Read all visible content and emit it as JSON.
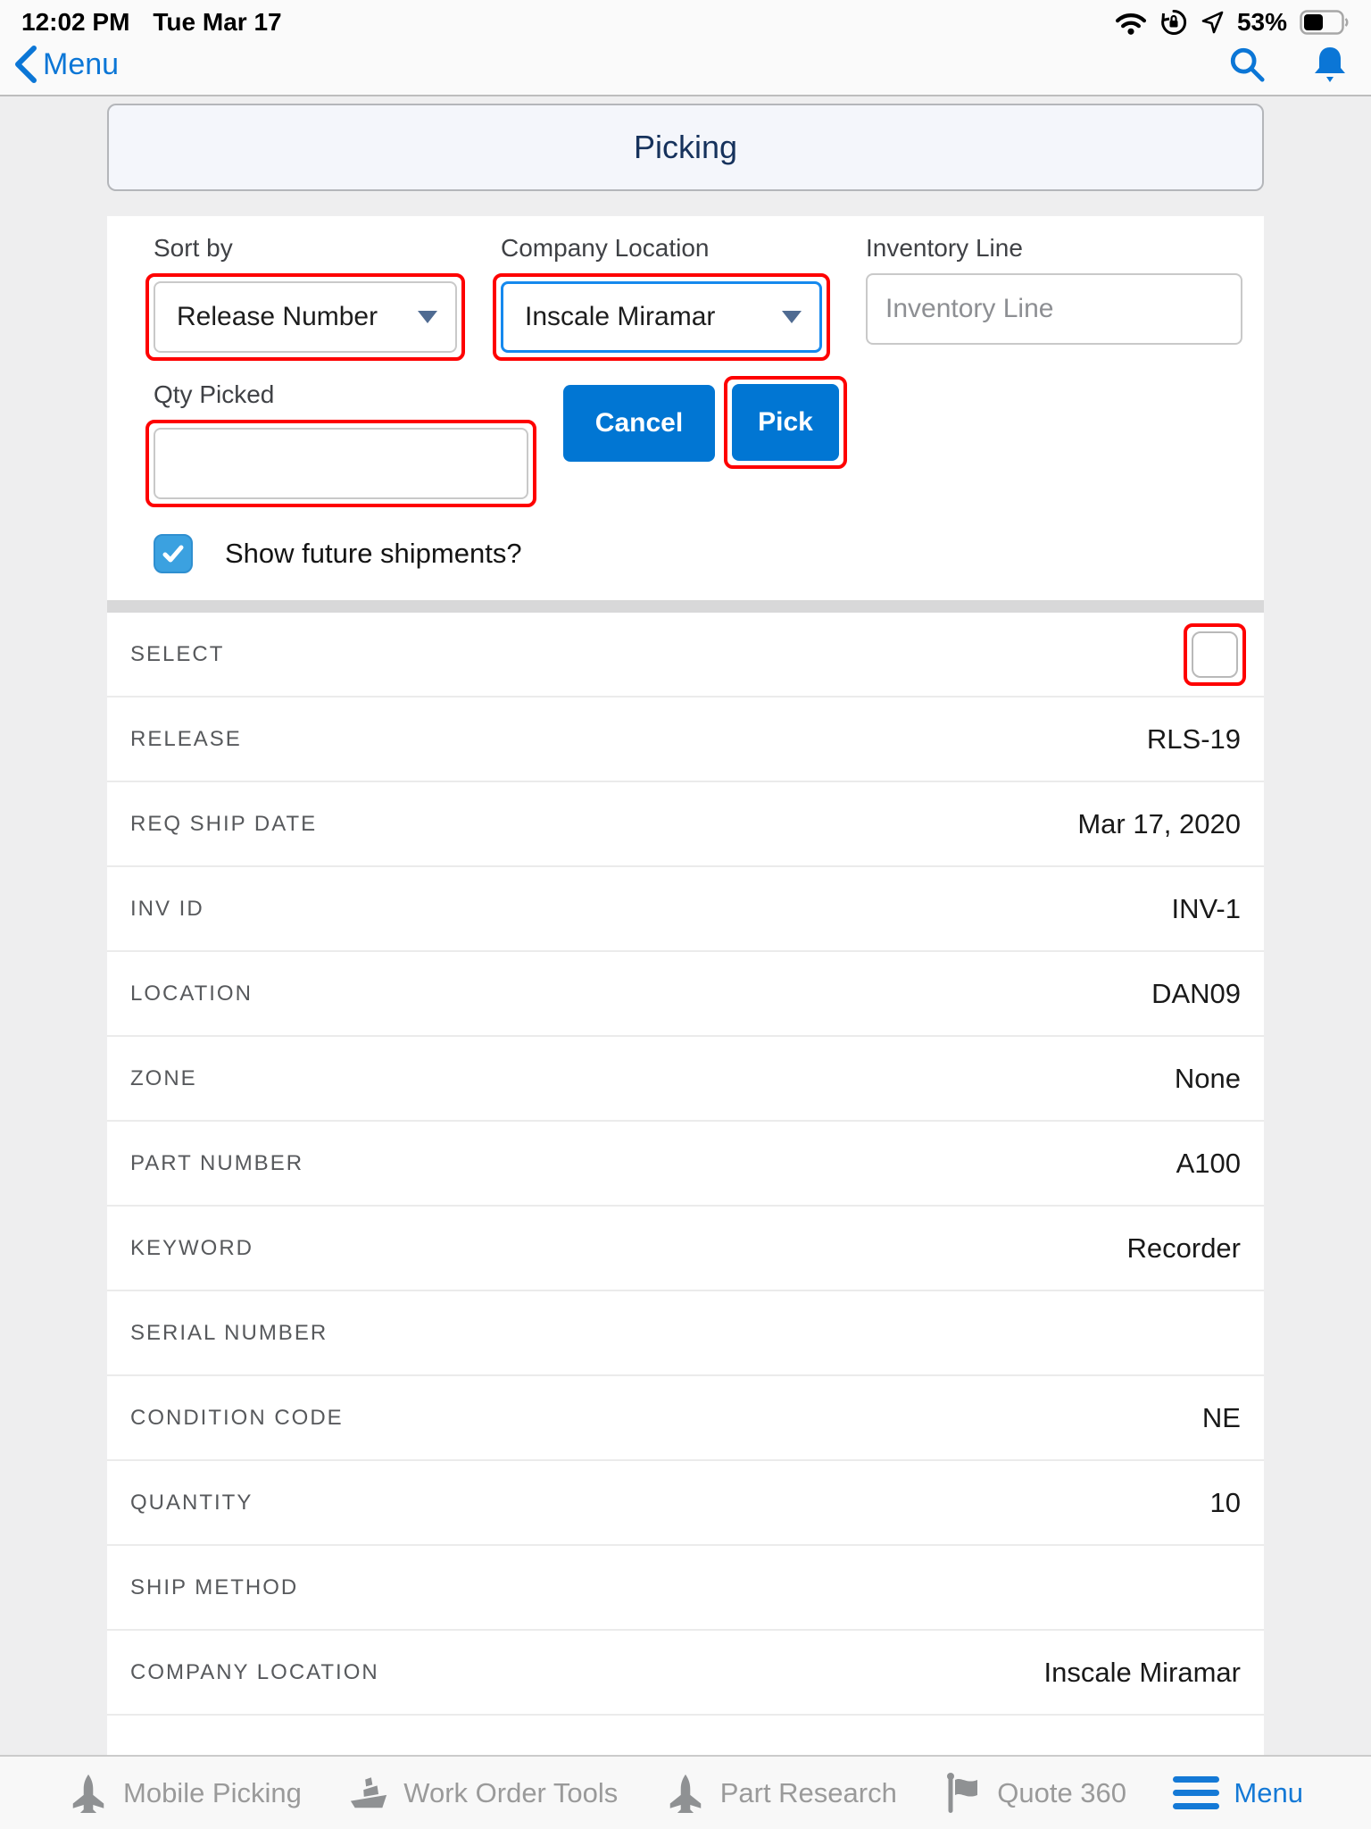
{
  "status_bar": {
    "time": "12:02 PM",
    "date": "Tue Mar 17",
    "battery_percent": "53%",
    "icons": [
      "wifi-icon",
      "rotation-lock-icon",
      "location-icon",
      "battery-icon"
    ]
  },
  "nav_bar": {
    "back_label": "Menu",
    "icons": [
      "back-chevron-icon",
      "search-icon",
      "bell-icon"
    ]
  },
  "page": {
    "title": "Picking"
  },
  "form": {
    "sort_by": {
      "label": "Sort by",
      "value": "Release Number"
    },
    "company_location": {
      "label": "Company Location",
      "value": "Inscale Miramar"
    },
    "inventory_line": {
      "label": "Inventory Line",
      "placeholder": "Inventory Line",
      "value": ""
    },
    "qty_picked": {
      "label": "Qty Picked",
      "value": ""
    },
    "cancel_label": "Cancel",
    "pick_label": "Pick",
    "show_future": {
      "label": "Show future shipments?",
      "checked": true
    }
  },
  "record": {
    "fields": [
      {
        "label": "SELECT",
        "type": "checkbox",
        "checked": false,
        "value": ""
      },
      {
        "label": "RELEASE",
        "value": "RLS-19"
      },
      {
        "label": "REQ SHIP DATE",
        "value": "Mar 17, 2020"
      },
      {
        "label": "INV ID",
        "value": "INV-1"
      },
      {
        "label": "LOCATION",
        "value": "DAN09"
      },
      {
        "label": "ZONE",
        "value": "None"
      },
      {
        "label": "PART NUMBER",
        "value": "A100"
      },
      {
        "label": "KEYWORD",
        "value": "Recorder"
      },
      {
        "label": "SERIAL NUMBER",
        "value": ""
      },
      {
        "label": "CONDITION CODE",
        "value": "NE"
      },
      {
        "label": "QUANTITY",
        "value": "10"
      },
      {
        "label": "SHIP METHOD",
        "value": ""
      },
      {
        "label": "COMPANY LOCATION",
        "value": "Inscale Miramar"
      }
    ]
  },
  "tab_bar": {
    "items": [
      {
        "label": "Mobile Picking",
        "icon": "rocket-icon",
        "active": false
      },
      {
        "label": "Work Order Tools",
        "icon": "ship-icon",
        "active": false
      },
      {
        "label": "Part Research",
        "icon": "plane-icon",
        "active": false
      },
      {
        "label": "Quote 360",
        "icon": "flag-icon",
        "active": false
      },
      {
        "label": "Menu",
        "icon": "menu-icon",
        "active": true
      }
    ]
  },
  "colors": {
    "accent_blue": "#0176d3",
    "nav_blue": "#0b76d6",
    "annotation_red": "#fe0000",
    "checkbox_blue": "#3ba1e0",
    "title_navy": "#16325c"
  }
}
